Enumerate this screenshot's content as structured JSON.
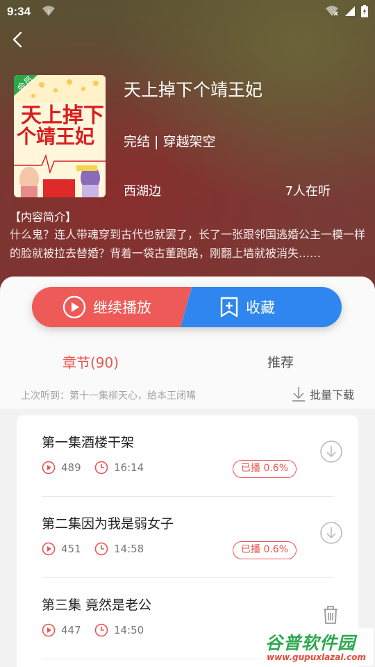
{
  "status_bar": {
    "time": "9:34"
  },
  "book": {
    "title": "天上掉下个靖王妃",
    "meta": "完结 | 穿越架空",
    "author": "西湖边",
    "listeners": "7人在听",
    "intro_label": "【内容简介】",
    "intro_text": "什么鬼？连人带魂穿到古代也就罢了，长了一张跟邻国逃婚公主一模一样的脸就被拉去替婚？背着一袋古董跑路，刚翻上墙就被消失……",
    "cover": {
      "badge": "会员",
      "title_line1": "天上掉下",
      "title_line2": "个靖王妃"
    }
  },
  "actions": {
    "continue_label": "继续播放",
    "collect_label": "收藏"
  },
  "tabs": {
    "chapters_label": "章节(90)",
    "recommend_label": "推荐"
  },
  "last_heard": "上次听到：第十一集柳天心，给本王闭嘴",
  "batch_download_label": "批量下载",
  "episodes": [
    {
      "title": "第一集酒楼干架",
      "plays": "489",
      "duration": "16:14",
      "progress": "已播 0.6%",
      "action_icon": "download-icon"
    },
    {
      "title": "第二集因为我是弱女子",
      "plays": "451",
      "duration": "14:58",
      "progress": "已播 0.6%",
      "action_icon": "download-icon"
    },
    {
      "title": "第三集 竟然是老公",
      "plays": "447",
      "duration": "14:50",
      "progress": "",
      "action_icon": "trash-icon"
    }
  ],
  "watermark": {
    "main": "谷普软件园",
    "url": "www.gupuxlazal.com"
  },
  "colors": {
    "accent_red": "#ee5a58",
    "accent_blue": "#2e86ee",
    "tab_active": "#e85552"
  }
}
